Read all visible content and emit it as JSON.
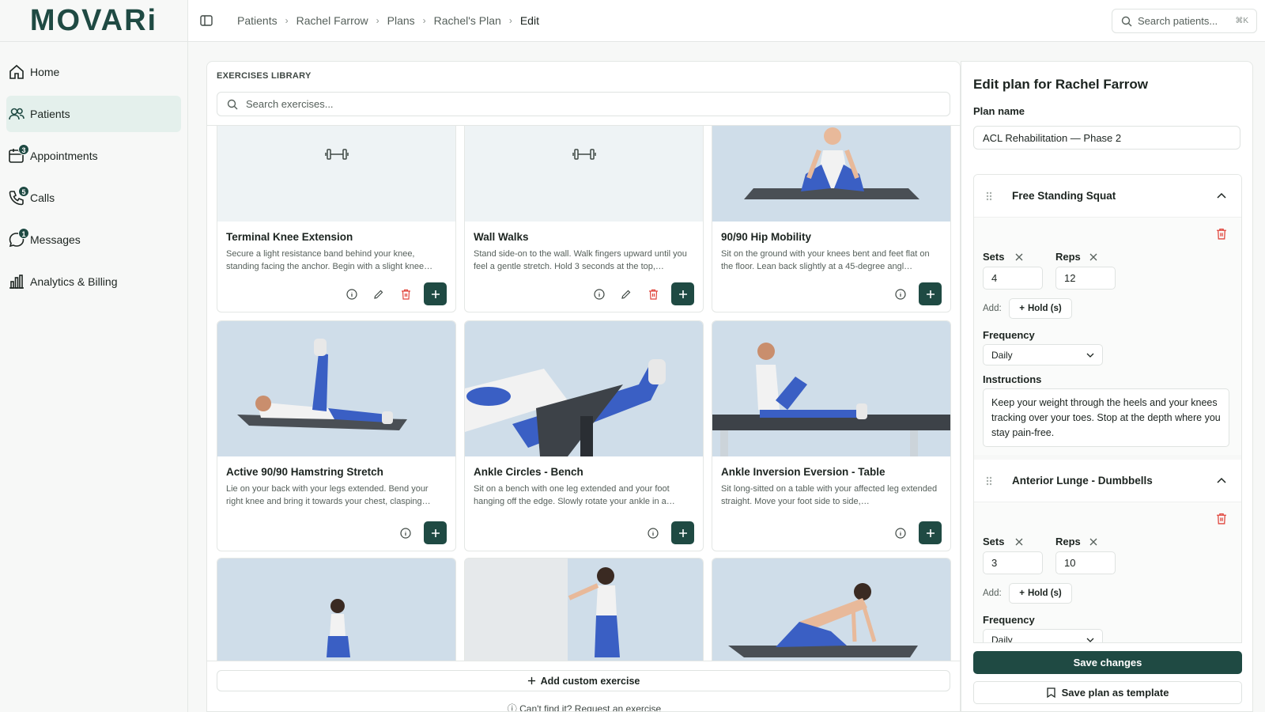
{
  "app": {
    "logo": "MOVARi"
  },
  "sidebar": {
    "items": [
      {
        "label": "Home",
        "icon": "home-icon",
        "badge": null,
        "active": false
      },
      {
        "label": "Patients",
        "icon": "users-icon",
        "badge": null,
        "active": true
      },
      {
        "label": "Appointments",
        "icon": "calendar-icon",
        "badge": "3",
        "active": false
      },
      {
        "label": "Calls",
        "icon": "phone-icon",
        "badge": "5",
        "active": false
      },
      {
        "label": "Messages",
        "icon": "chat-icon",
        "badge": "1",
        "active": false
      },
      {
        "label": "Analytics & Billing",
        "icon": "bar-chart-icon",
        "badge": null,
        "active": false
      }
    ]
  },
  "breadcrumb": [
    "Patients",
    "Rachel Farrow",
    "Plans",
    "Rachel's Plan",
    "Edit"
  ],
  "search": {
    "placeholder": "Search patients...",
    "shortcut": "⌘K"
  },
  "library": {
    "title": "EXERCISES LIBRARY",
    "search_placeholder": "Search exercises...",
    "cards": [
      {
        "title": "Terminal Knee Extension",
        "desc": "Secure a light resistance band behind your knee, standing facing the anchor. Begin with a slight knee…",
        "image": "placeholder",
        "editable": true
      },
      {
        "title": "Wall Walks",
        "desc": "Stand side-on to the wall. Walk fingers upward until you feel a gentle stretch. Hold 3 seconds at the top,…",
        "image": "placeholder",
        "editable": true
      },
      {
        "title": "90/90 Hip Mobility",
        "desc": "Sit on the ground with your knees bent and feet flat on the floor. Lean back slightly at a 45-degree angl…",
        "image": "photo",
        "editable": false
      },
      {
        "title": "Active 90/90 Hamstring Stretch",
        "desc": "Lie on your back with your legs extended. Bend your right knee and bring it towards your chest, clasping…",
        "image": "photo",
        "editable": false
      },
      {
        "title": "Ankle Circles - Bench",
        "desc": "Sit on a bench with one leg extended and your foot hanging off the edge. Slowly rotate your ankle in a…",
        "image": "photo",
        "editable": false
      },
      {
        "title": "Ankle Inversion Eversion - Table",
        "desc": "Sit long-sitted on a table with your affected leg extended straight. Move your foot side to side,…",
        "image": "photo",
        "editable": false
      }
    ],
    "add_custom_label": "Add custom exercise",
    "request_label": "Can't find it? Request an exercise"
  },
  "editor": {
    "title": "Edit plan for Rachel Farrow",
    "plan_name_label": "Plan name",
    "plan_name_value": "ACL Rehabilitation — Phase 2",
    "exercises": [
      {
        "name": "Free Standing Squat",
        "sets_label": "Sets",
        "sets": "4",
        "reps_label": "Reps",
        "reps": "12",
        "add_label": "Add:",
        "hold_label": "Hold (s)",
        "frequency_label": "Frequency",
        "frequency": "Daily",
        "instructions_label": "Instructions",
        "instructions": "Keep your weight through the heels and your knees tracking over your toes. Stop at the depth where you stay pain-free."
      },
      {
        "name": "Anterior Lunge - Dumbbells",
        "sets_label": "Sets",
        "sets": "3",
        "reps_label": "Reps",
        "reps": "10",
        "add_label": "Add:",
        "hold_label": "Hold (s)",
        "frequency_label": "Frequency",
        "frequency": "Daily"
      }
    ],
    "save_label": "Save changes",
    "template_label": "Save plan as template"
  },
  "colors": {
    "brand": "#1f4a43",
    "accent": "#2b9d8c",
    "danger": "#e0453c",
    "active_nav": "#e4f0ec"
  }
}
